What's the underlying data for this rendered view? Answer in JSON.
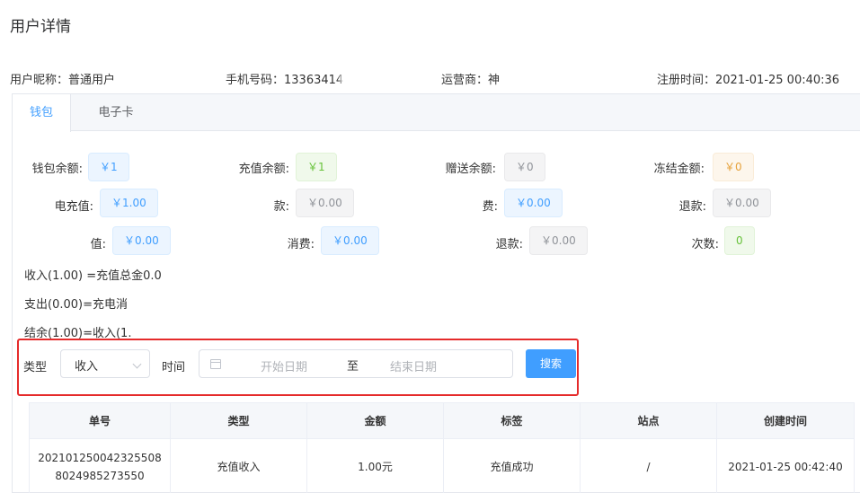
{
  "page_title": "用户详情",
  "user_info": {
    "nickname": "用户昵称：普通用户",
    "phone": "手机号码：13363414",
    "operator": "运营商：神",
    "register": "注册时间：2021-01-25 00:40:36"
  },
  "tabs": [
    {
      "label": "钱包",
      "active": true
    },
    {
      "label": "电子卡",
      "active": false
    }
  ],
  "wallet": {
    "row1": [
      {
        "label": "钱包余额:",
        "value": "￥1",
        "color": "blue"
      },
      {
        "label": "充值余额:",
        "value": "￥1",
        "color": "green"
      },
      {
        "label": "赠送余额:",
        "value": "￥0",
        "color": "gray"
      },
      {
        "label": "冻结金额:",
        "value": "￥0",
        "color": "orange"
      }
    ],
    "row2": [
      {
        "label": "电充值:",
        "value": "￥1.00",
        "color": "blue"
      },
      {
        "label": "款:",
        "value": "￥0.00",
        "color": "gray"
      },
      {
        "label": "费:",
        "value": "￥0.00",
        "color": "blue"
      },
      {
        "label": "退款:",
        "value": "￥0.00",
        "color": "gray"
      }
    ],
    "row3": [
      {
        "label": "值:",
        "value": "￥0.00",
        "color": "blue"
      },
      {
        "label": "消费:",
        "value": "￥0.00",
        "color": "blue"
      },
      {
        "label": "退款:",
        "value": "￥0.00",
        "color": "gray"
      },
      {
        "label": "次数:",
        "value": "0",
        "color": "green"
      }
    ]
  },
  "formulas": {
    "income": "收入(1.00) =充值总金0.0",
    "expense": "支出(0.00)=充电消",
    "balance": "结余(1.00)=收入(1."
  },
  "filter": {
    "type_label": "类型",
    "type_value": "收入",
    "time_label": "时间",
    "start_placeholder": "开始日期",
    "range_separator": "至",
    "end_placeholder": "结束日期",
    "search_label": "搜索"
  },
  "table": {
    "headers": [
      "单号",
      "类型",
      "金额",
      "标签",
      "站点",
      "创建时间"
    ],
    "rows": [
      [
        "2021012500423255088024985273550",
        "充值收入",
        "1.00元",
        "充值成功",
        "/",
        "2021-01-25 00:42:40"
      ]
    ]
  },
  "colors": {
    "accent": "#409eff",
    "highlight_border": "#e52b2b"
  }
}
